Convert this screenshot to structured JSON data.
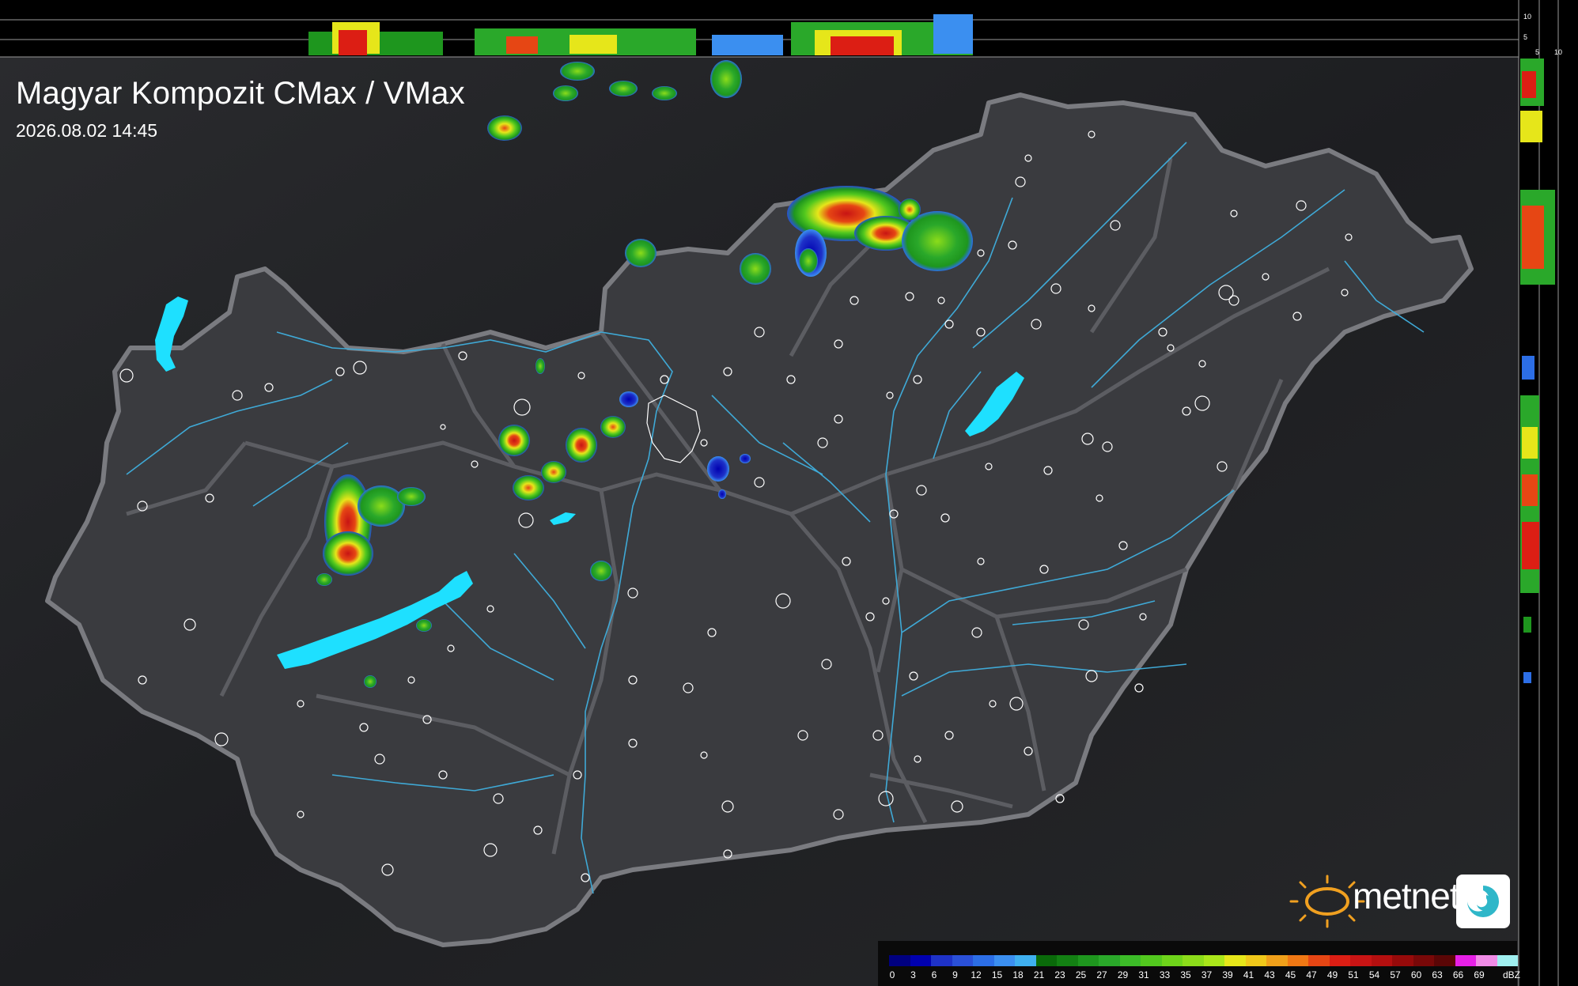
{
  "map": {
    "title": "Magyar Kompozit CMax / VMax",
    "timestamp": "2026.08.02 14:45",
    "brand": "metnet"
  },
  "profile": {
    "top_axis_ticks": [
      "10",
      "5"
    ],
    "side_axis_ticks": [
      "5",
      "10"
    ]
  },
  "legend": {
    "unit": "dBZ",
    "stops": [
      {
        "label": "0",
        "color": "#000080"
      },
      {
        "label": "3",
        "color": "#0000b0"
      },
      {
        "label": "6",
        "color": "#1e32c8"
      },
      {
        "label": "9",
        "color": "#2a50d8"
      },
      {
        "label": "12",
        "color": "#2c6ee6"
      },
      {
        "label": "15",
        "color": "#3b8ff0"
      },
      {
        "label": "18",
        "color": "#3fb0f0"
      },
      {
        "label": "21",
        "color": "#0a6a0a"
      },
      {
        "label": "23",
        "color": "#138013"
      },
      {
        "label": "25",
        "color": "#1e961e"
      },
      {
        "label": "27",
        "color": "#2aa82a"
      },
      {
        "label": "29",
        "color": "#3cbc28"
      },
      {
        "label": "31",
        "color": "#52c81e"
      },
      {
        "label": "33",
        "color": "#6ed41a"
      },
      {
        "label": "35",
        "color": "#8cdc1a"
      },
      {
        "label": "37",
        "color": "#aae61a"
      },
      {
        "label": "39",
        "color": "#e6e61a"
      },
      {
        "label": "41",
        "color": "#f0c81a"
      },
      {
        "label": "43",
        "color": "#f0a01a"
      },
      {
        "label": "45",
        "color": "#f07814"
      },
      {
        "label": "47",
        "color": "#e64614"
      },
      {
        "label": "49",
        "color": "#dc1e14"
      },
      {
        "label": "51",
        "color": "#c81414"
      },
      {
        "label": "54",
        "color": "#b40f0f"
      },
      {
        "label": "57",
        "color": "#960a0a"
      },
      {
        "label": "60",
        "color": "#780808"
      },
      {
        "label": "63",
        "color": "#5a0606"
      },
      {
        "label": "66",
        "color": "#e620e6"
      },
      {
        "label": "69",
        "color": "#f08ce6"
      },
      {
        "label": "",
        "color": "#a0f0f0"
      }
    ]
  },
  "colors": {
    "background": "#1e1f22",
    "country": "#3a3b3f",
    "border": "#7a7b80",
    "rivers": "#3fa9d6",
    "lakes": "#1ee0ff",
    "settlements": "#ffffff",
    "brand_sun": "#f0a020"
  }
}
